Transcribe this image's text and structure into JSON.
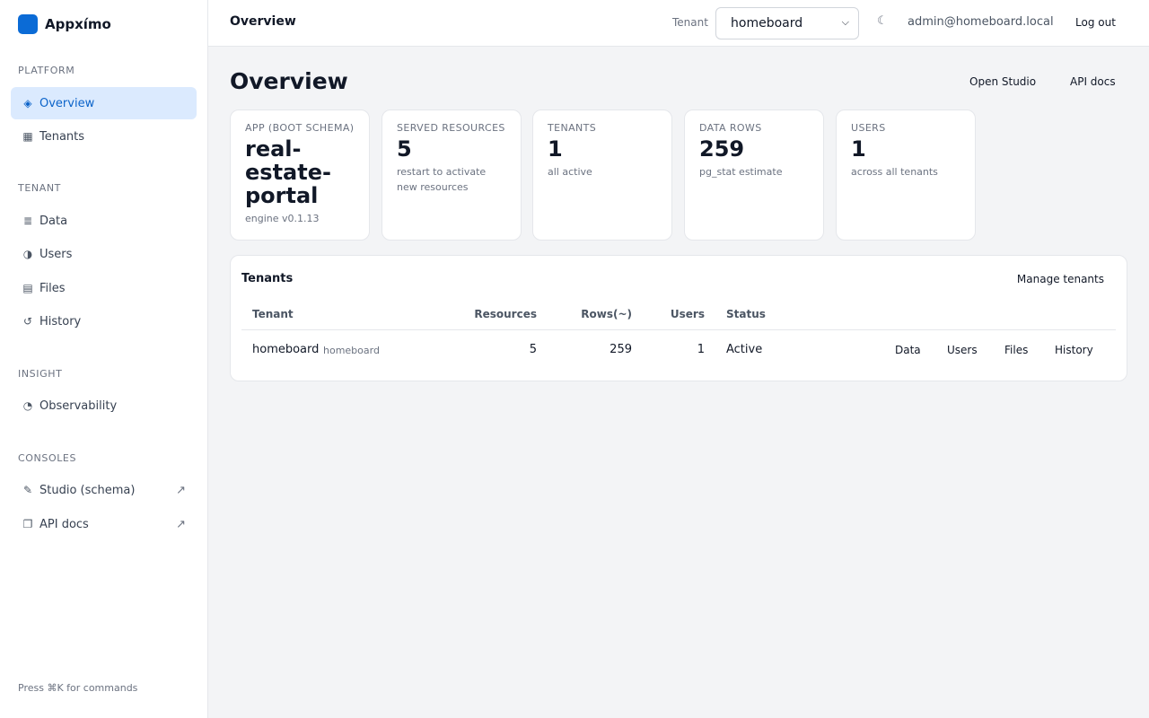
{
  "brand": {
    "name": "Appxímo",
    "logo_color": "#0b6bd6"
  },
  "sidebar": {
    "sections": {
      "platform": "PLATFORM",
      "tenant": "TENANT",
      "insight": "INSIGHT",
      "consoles": "CONSOLES"
    },
    "items": [
      {
        "label": "Overview",
        "icon": "diamond-icon",
        "glyph": "◈",
        "active": true
      },
      {
        "label": "Tenants",
        "icon": "grid-icon",
        "glyph": "▦"
      },
      {
        "label": "Data",
        "icon": "list-icon",
        "glyph": "≣"
      },
      {
        "label": "Users",
        "icon": "half-circle-icon",
        "glyph": "◑"
      },
      {
        "label": "Files",
        "icon": "file-icon",
        "glyph": "▤"
      },
      {
        "label": "History",
        "icon": "history-icon",
        "glyph": "↺"
      },
      {
        "label": "Observability",
        "icon": "pie-icon",
        "glyph": "◔"
      },
      {
        "label": "Studio (schema)",
        "icon": "pencil-icon",
        "glyph": "✎",
        "external": "↗"
      },
      {
        "label": "API docs",
        "icon": "copy-icon",
        "glyph": "❐",
        "external": "↗"
      }
    ],
    "hint": "Press ⌘K for commands"
  },
  "topbar": {
    "title": "Overview",
    "tenant_label": "Tenant",
    "tenant_selected": "homeboard",
    "theme_glyph": "☾",
    "user_email": "admin@homeboard.local",
    "logout": "Log out"
  },
  "main": {
    "title": "Overview",
    "actions": {
      "studio": "Open Studio",
      "api_docs": "API docs"
    },
    "cards": [
      {
        "label": "APP (BOOT SCHEMA)",
        "value": "real-estate-portal",
        "sub": "engine v0.1.13"
      },
      {
        "label": "SERVED RESOURCES",
        "value": "5",
        "sub": "restart to activate new resources"
      },
      {
        "label": "TENANTS",
        "value": "1",
        "sub": "all active"
      },
      {
        "label": "DATA ROWS",
        "value": "259",
        "sub": "pg_stat estimate"
      },
      {
        "label": "USERS",
        "value": "1",
        "sub": "across all tenants"
      }
    ]
  },
  "tenants_panel": {
    "title": "Tenants",
    "manage": "Manage tenants",
    "columns": [
      "Tenant",
      "Resources",
      "Rows(~)",
      "Users",
      "Status"
    ],
    "rows": [
      {
        "name": "homeboard",
        "slug": "homeboard",
        "resources": "5",
        "rows": "259",
        "users": "1",
        "status": "Active",
        "links": [
          "Data",
          "Users",
          "Files",
          "History"
        ]
      }
    ]
  },
  "colors": {
    "accent": "#0b63c9",
    "active_bg": "#dbeafe",
    "page_bg": "#f3f4f6"
  }
}
